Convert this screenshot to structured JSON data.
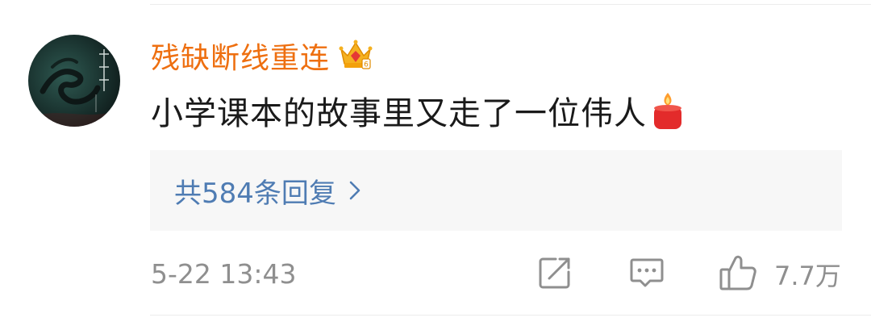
{
  "comment": {
    "username": "残缺断线重连",
    "text": "小学课本的故事里又走了一位伟人",
    "reply_summary": "共584条回复",
    "timestamp": "5-22 13:43",
    "like_count": "7.7万",
    "badge_icon": "crown-icon",
    "emoji_icon": "candle-icon"
  },
  "colors": {
    "username": "#ee6f10",
    "reply_link": "#4f7cb3",
    "meta_text": "#8f8f8f",
    "reply_box_bg": "#f7f7f7"
  }
}
